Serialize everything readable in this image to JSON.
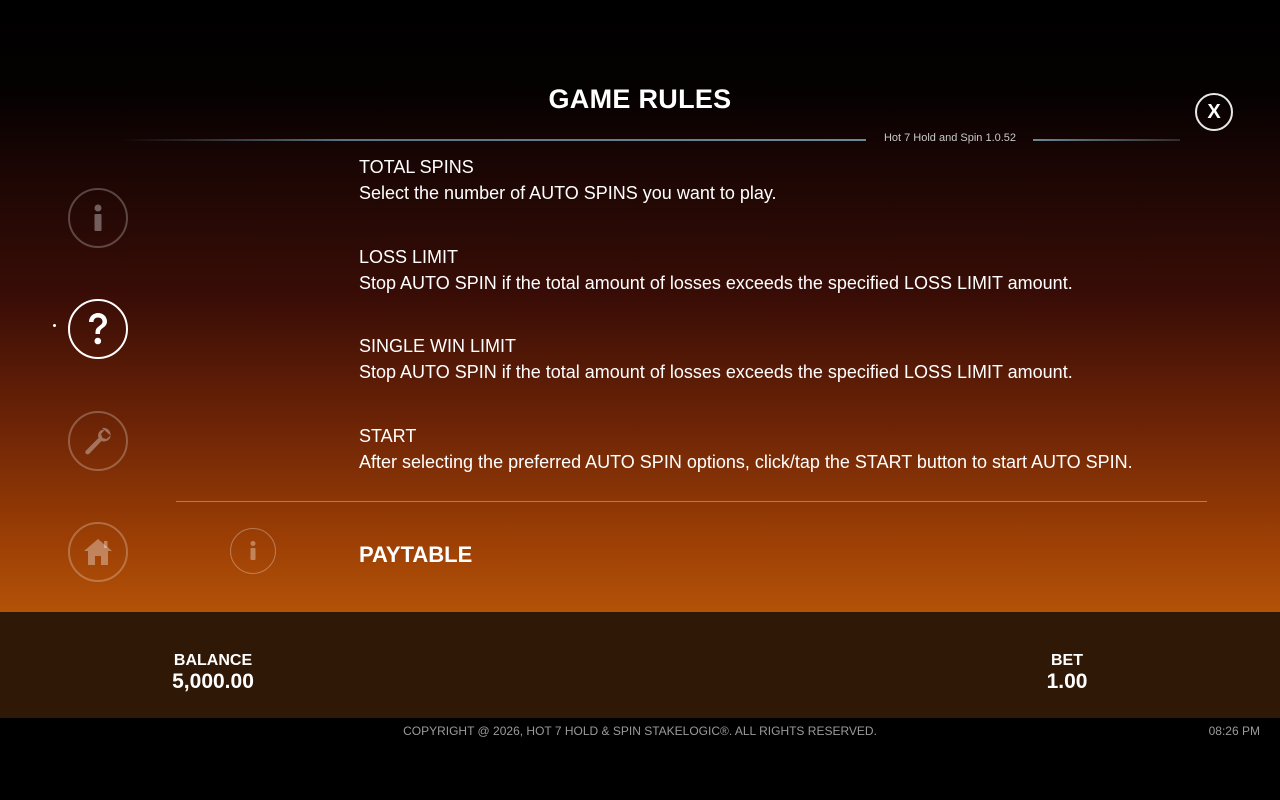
{
  "header": {
    "title": "GAME RULES",
    "version": "Hot 7 Hold and Spin 1.0.52",
    "close_label": "X"
  },
  "sections": [
    {
      "heading": "TOTAL SPINS",
      "text": "Select the number of AUTO SPINS you want to play."
    },
    {
      "heading": "LOSS LIMIT",
      "text": "Stop AUTO SPIN if the total amount of losses exceeds the specified LOSS LIMIT amount."
    },
    {
      "heading": "SINGLE WIN LIMIT",
      "text": "Stop AUTO SPIN if the total amount of losses exceeds the specified LOSS LIMIT amount."
    },
    {
      "heading": "START",
      "text": "After selecting the preferred AUTO SPIN options, click/tap the START button to start AUTO SPIN."
    }
  ],
  "paytable": {
    "label": "PAYTABLE",
    "icon": "info-icon"
  },
  "sidebar": {
    "items": [
      {
        "icon": "info-icon",
        "active": false
      },
      {
        "icon": "question-icon",
        "active": true
      },
      {
        "icon": "wrench-icon",
        "active": false
      },
      {
        "icon": "home-icon",
        "active": false
      }
    ]
  },
  "footer": {
    "balance_label": "BALANCE",
    "balance_value": "5,000.00",
    "bet_label": "BET",
    "bet_value": "1.00",
    "copyright": "COPYRIGHT @ 2026, HOT 7 HOLD & SPIN STAKELOGIC®. ALL RIGHTS RESERVED.",
    "time": "08:26 PM"
  },
  "colors": {
    "bg_top": "#000000",
    "bg_bottom": "#b35208",
    "footer_bar": "#301807",
    "text": "#ffffff",
    "muted": "#9a9a9a"
  }
}
